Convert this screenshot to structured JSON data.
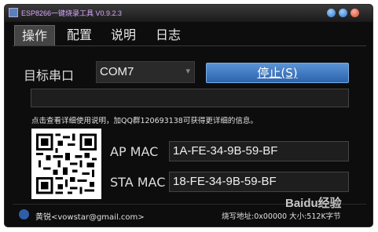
{
  "window": {
    "title": "ESP8266一键烧录工具 V0.9.2.3"
  },
  "tabs": [
    "操作",
    "配置",
    "说明",
    "日志"
  ],
  "port": {
    "label": "目标串口",
    "value": "COM7"
  },
  "stop_button": "停止(S)",
  "status_text": "",
  "info_text": "点击查看详细使用说明，加QQ群120693138可获得更详细的信息。",
  "ap_mac": {
    "label": "AP MAC",
    "value": "1A-FE-34-9B-59-BF"
  },
  "sta_mac": {
    "label": "STA MAC",
    "value": "18-FE-34-9B-59-BF"
  },
  "footer": {
    "email": "黄锐<vowstar@gmail.com>",
    "address": "烧写地址:0x00000 大小:512K字节"
  },
  "watermark": "Baidu经验",
  "colors": {
    "title": "#d8a7ff",
    "button": "#3b76c4",
    "background": "#0d0d0d"
  }
}
